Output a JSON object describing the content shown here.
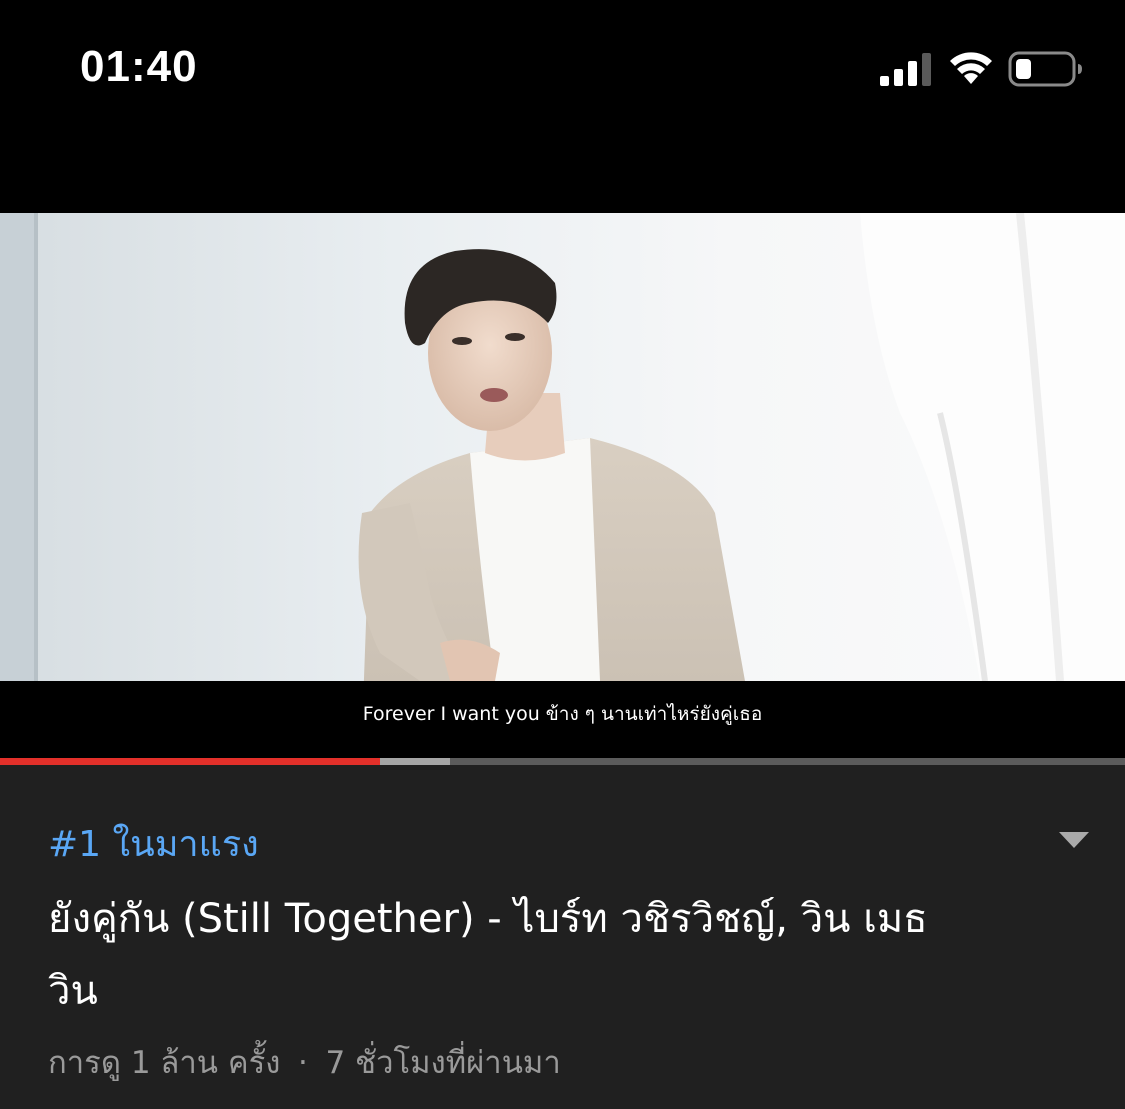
{
  "status_bar": {
    "time": "01:40",
    "signal_icon": "cellular-signal-icon",
    "wifi_icon": "wifi-icon",
    "battery_icon": "battery-low-icon"
  },
  "player": {
    "subtitle": "Forever I want you ข้าง ๆ นานเท่าไหร่ยังคู่เธอ",
    "progress": {
      "played_fraction": 0.338,
      "buffered_fraction": 0.4
    },
    "colors": {
      "played": "#e3302a",
      "buffered": "#a6a6a6",
      "track": "#5b5b5b"
    }
  },
  "video_info": {
    "trending_label": "#1 ในมาแรง",
    "title": "ยังคู่กัน (Still Together) - ไบร์ท วชิรวิชญ์, วิน เมธวิน",
    "views": "การดู 1 ล้าน ครั้ง",
    "separator": "·",
    "published": "7 ชั่วโมงที่ผ่านมา",
    "expand_icon": "chevron-down-icon",
    "colors": {
      "trending": "#5aa7f5",
      "meta": "#9a9a9a",
      "panel_bg": "#202020"
    }
  }
}
